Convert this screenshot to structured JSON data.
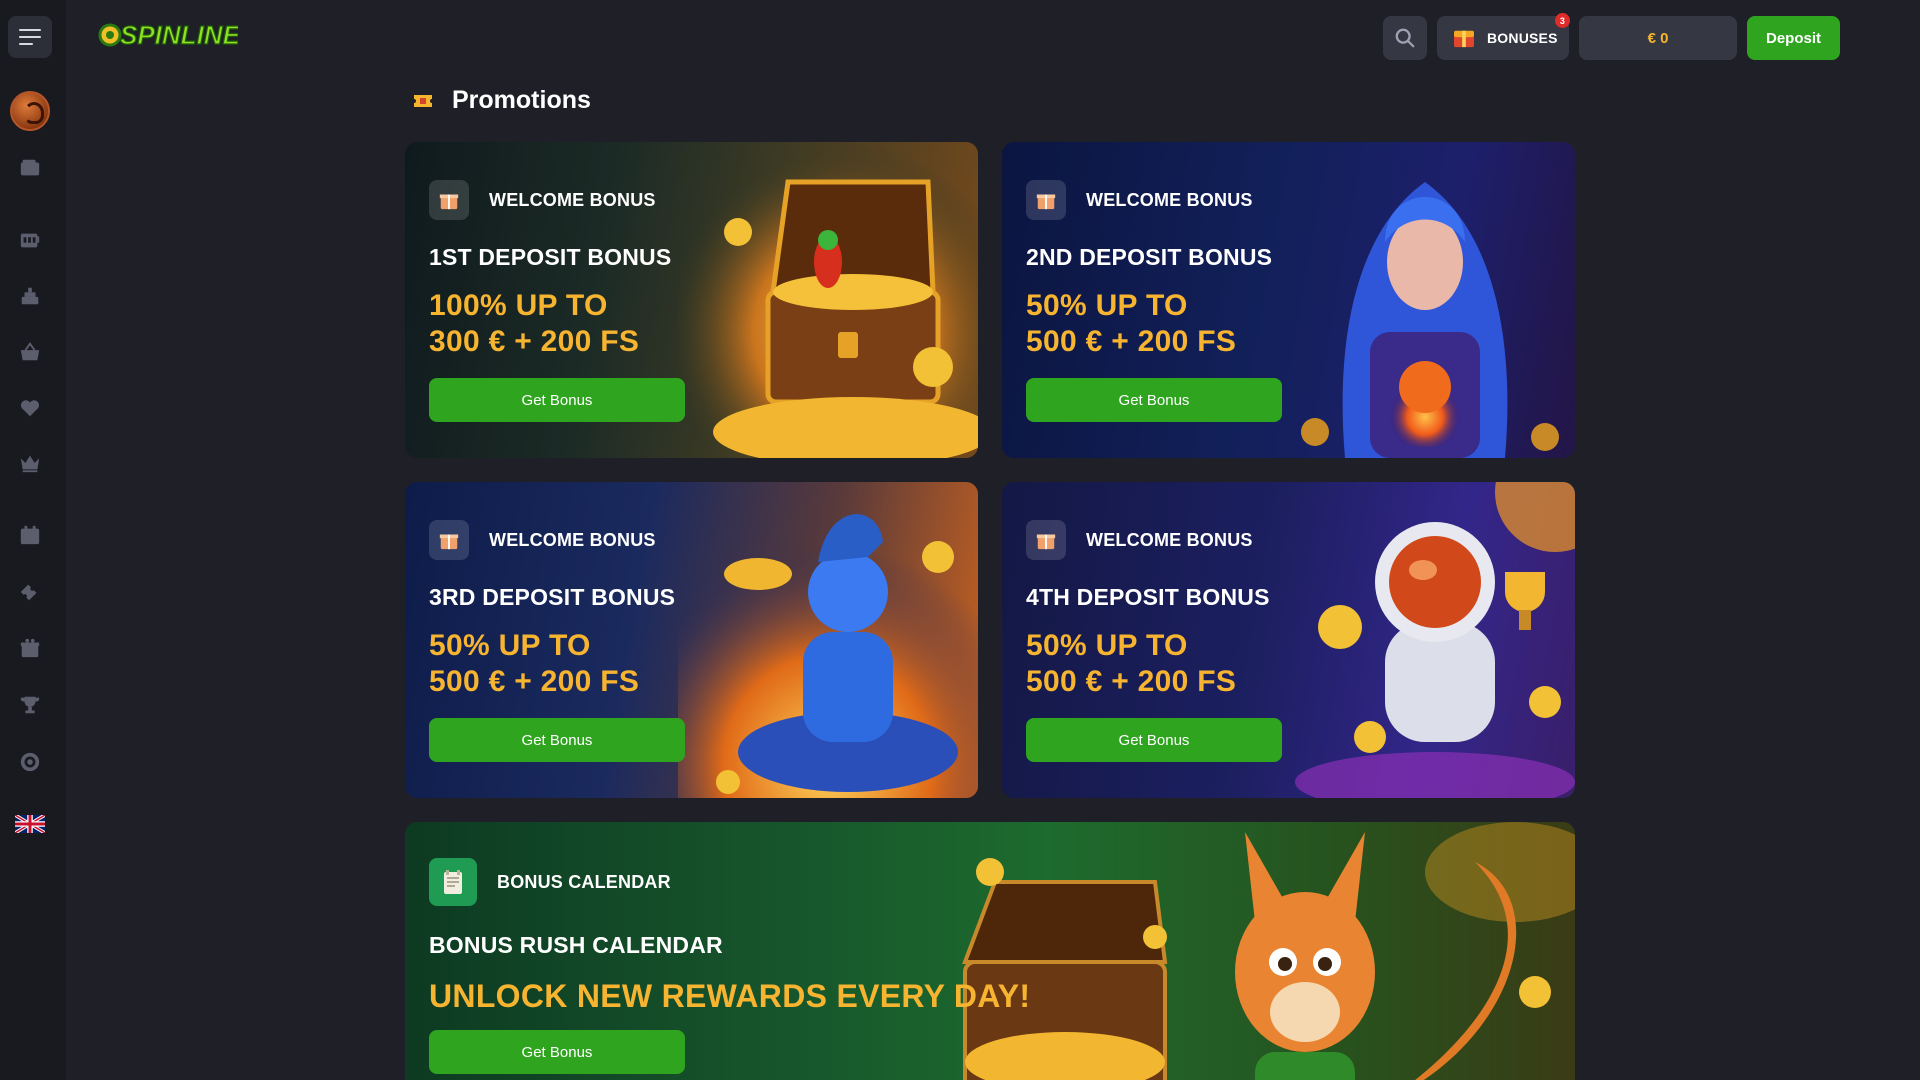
{
  "header": {
    "logo_text": "SPINLINE",
    "bonuses_label": "BONUSES",
    "bonuses_badge": "3",
    "balance": "€ 0",
    "deposit_label": "Deposit"
  },
  "sidebar": {
    "icons": [
      "avatar",
      "wallet-icon",
      "slots-icon",
      "casino-icon",
      "basket-icon",
      "heart-icon",
      "crown-icon",
      "calendar-icon",
      "ticket-icon",
      "gift-icon",
      "trophy-icon",
      "target-icon",
      "uk-flag-icon"
    ]
  },
  "page": {
    "title": "Promotions"
  },
  "promotions": [
    {
      "tag": "WELCOME BONUS",
      "title": "1ST DEPOSIT BONUS",
      "offer_line1": "100% UP TO",
      "offer_line2": "300 € + 200 FS",
      "button": "Get Bonus"
    },
    {
      "tag": "WELCOME BONUS",
      "title": "2ND DEPOSIT BONUS",
      "offer_line1": "50% UP TO",
      "offer_line2": "500 € + 200 FS",
      "button": "Get Bonus"
    },
    {
      "tag": "WELCOME BONUS",
      "title": "3RD DEPOSIT BONUS",
      "offer_line1": "50% UP TO",
      "offer_line2": "500 € + 200 FS",
      "button": "Get Bonus"
    },
    {
      "tag": "WELCOME BONUS",
      "title": "4TH DEPOSIT BONUS",
      "offer_line1": "50% UP TO",
      "offer_line2": "500 € + 200 FS",
      "button": "Get Bonus"
    }
  ],
  "calendar": {
    "tag": "BONUS CALENDAR",
    "title": "BONUS RUSH CALENDAR",
    "offer": "UNLOCK NEW REWARDS EVERY DAY!",
    "button": "Get Bonus"
  },
  "colors": {
    "accent_green": "#2fa51f",
    "offer_gold": "#f7b430",
    "background": "#1f2027"
  }
}
